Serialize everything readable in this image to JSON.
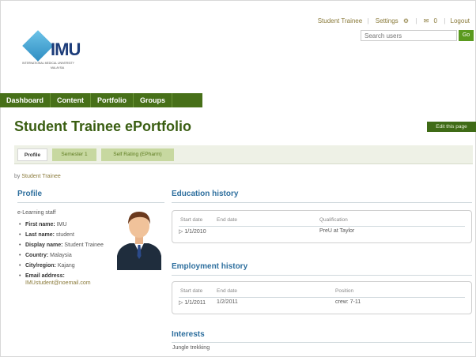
{
  "header": {
    "user_name": "Student Trainee",
    "settings_label": "Settings",
    "messages_label": "0",
    "logout_label": "Logout",
    "search_placeholder": "Search users",
    "go_label": "Go"
  },
  "logo": {
    "text": "IMU",
    "subtitle_line1": "INTERNATIONAL MEDICAL UNIVERSITY",
    "subtitle_line2": "MALAYSIA"
  },
  "nav": {
    "items": [
      "Dashboard",
      "Content",
      "Portfolio",
      "Groups"
    ]
  },
  "page": {
    "title": "Student Trainee ePortfolio",
    "edit_button": "Edit this page",
    "tabs": [
      "Profile",
      "Semester 1",
      "Self Rating (EPharm)"
    ],
    "byline_prefix": "by",
    "byline_user": "Student Trainee"
  },
  "profile": {
    "heading": "Profile",
    "role": "e-Learning staff",
    "fields": [
      {
        "label": "First name:",
        "value": "IMU"
      },
      {
        "label": "Last name:",
        "value": "student"
      },
      {
        "label": "Display name:",
        "value": "Student Trainee"
      },
      {
        "label": "Country:",
        "value": "Malaysia"
      },
      {
        "label": "City/region:",
        "value": "Kajang"
      },
      {
        "label": "Email address:",
        "value": "IMUstudent@noemail.com"
      }
    ]
  },
  "education": {
    "heading": "Education history",
    "columns": [
      "Start date",
      "End date",
      "Qualification"
    ],
    "rows": [
      {
        "start": "1/1/2010",
        "end": "",
        "qualification": "PreU at Taylor"
      }
    ]
  },
  "employment": {
    "heading": "Employment history",
    "columns": [
      "Start date",
      "End date",
      "Position"
    ],
    "rows": [
      {
        "start": "1/1/2011",
        "end": "1/2/2011",
        "position": "crew: 7-11"
      }
    ]
  },
  "interests": {
    "heading": "Interests",
    "value": "Jungle trekking"
  },
  "colors": {
    "nav_green": "#477019",
    "title_green": "#3a5e12",
    "heading_blue": "#2e6f9e",
    "link_brown": "#8a7a3a"
  }
}
